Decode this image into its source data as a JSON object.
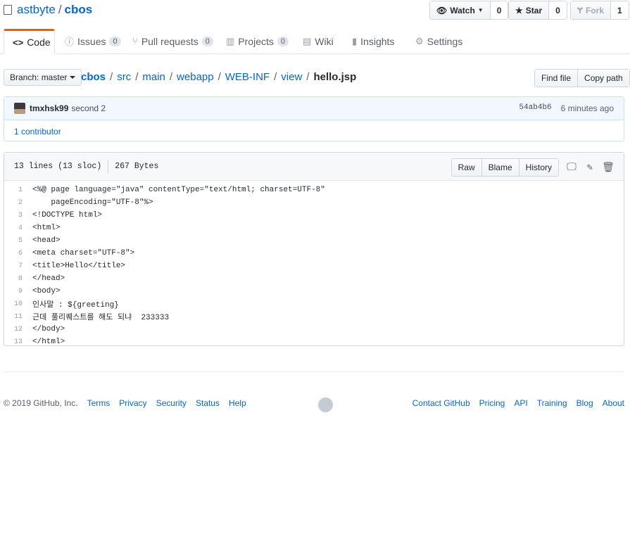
{
  "repo": {
    "owner": "astbyte",
    "separator": "/",
    "name": "cbos"
  },
  "social": {
    "watch": {
      "label": "Watch",
      "count": "0"
    },
    "star": {
      "label": "Star",
      "count": "0"
    },
    "fork": {
      "label": "Fork",
      "count": "1"
    }
  },
  "tabs": [
    {
      "label": "Code",
      "icon": "code-icon"
    },
    {
      "label": "Issues",
      "count": "0",
      "icon": "issue-icon"
    },
    {
      "label": "Pull requests",
      "count": "0",
      "icon": "pull-request-icon"
    },
    {
      "label": "Projects",
      "count": "0",
      "icon": "project-icon"
    },
    {
      "label": "Wiki",
      "icon": "book-icon"
    },
    {
      "label": "Insights",
      "icon": "graph-icon"
    },
    {
      "label": "Settings",
      "icon": "gear-icon"
    }
  ],
  "branch": {
    "label": "Branch: master"
  },
  "breadcrumb": [
    "cbos",
    "src",
    "main",
    "webapp",
    "WEB-INF",
    "view",
    "hello.jsp"
  ],
  "file_nav": {
    "find_file": "Find file",
    "copy_path": "Copy path"
  },
  "commit": {
    "author": "tmxhsk99",
    "message": "second 2",
    "sha": "54ab4b6",
    "time": "6 minutes ago",
    "contributors": "1 contributor"
  },
  "file": {
    "lines_info": "13 lines (13 sloc)",
    "size": "267 Bytes",
    "raw": "Raw",
    "blame": "Blame",
    "history": "History"
  },
  "code_lines": [
    "<%@ page language=\"java\" contentType=\"text/html; charset=UTF-8\"",
    "    pageEncoding=\"UTF-8\"%>",
    "<!DOCTYPE html>",
    "<html>",
    "<head>",
    "<meta charset=\"UTF-8\">",
    "<title>Hello</title>",
    "</head>",
    "<body>",
    "인사말 : ${greeting}",
    "근데 풀리퀘스트를 해도 되냐  233333",
    "</body>",
    "</html>"
  ],
  "footer": {
    "copyright": "© 2019 GitHub, Inc.",
    "left_links": [
      "Terms",
      "Privacy",
      "Security",
      "Status",
      "Help"
    ],
    "right_links": [
      "Contact GitHub",
      "Pricing",
      "API",
      "Training",
      "Blog",
      "About"
    ]
  }
}
